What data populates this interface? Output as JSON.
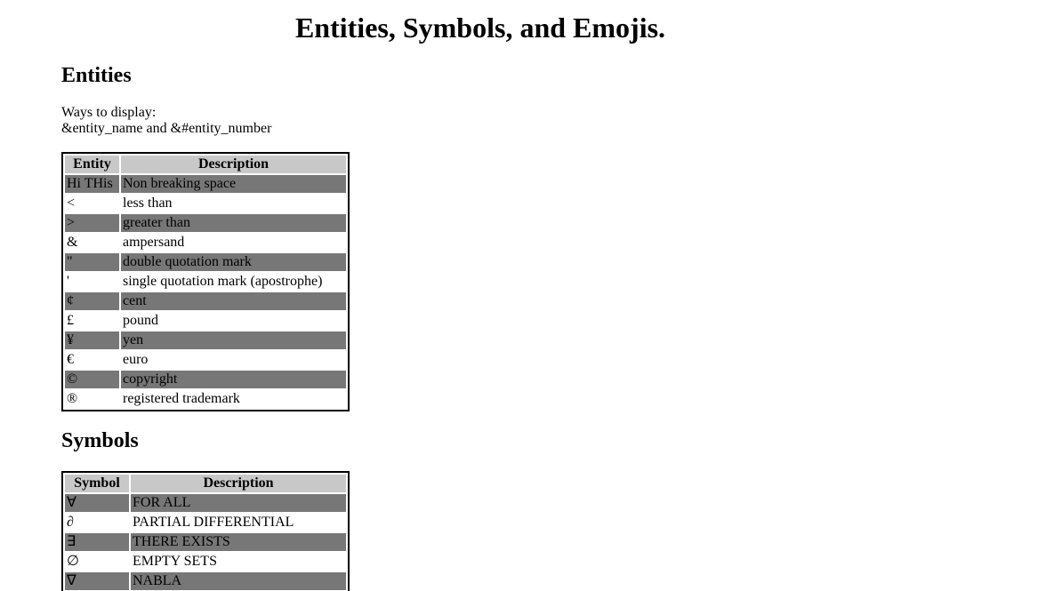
{
  "title": "Entities, Symbols, and Emojis.",
  "entities": {
    "heading": "Entities",
    "intro_line1": "Ways to display:",
    "intro_line2": "&entity_name and &#entity_number",
    "columns": [
      "Entity",
      "Description"
    ],
    "rows": [
      {
        "symbol": "Hi THis",
        "description": "Non breaking space"
      },
      {
        "symbol": "<",
        "description": "less than"
      },
      {
        "symbol": ">",
        "description": "greater than"
      },
      {
        "symbol": "&",
        "description": "ampersand"
      },
      {
        "symbol": "\"",
        "description": "double quotation mark"
      },
      {
        "symbol": "'",
        "description": "single quotation mark (apostrophe)"
      },
      {
        "symbol": "¢",
        "description": "cent"
      },
      {
        "symbol": "£",
        "description": "pound"
      },
      {
        "symbol": "¥",
        "description": "yen"
      },
      {
        "symbol": "€",
        "description": "euro"
      },
      {
        "symbol": "©",
        "description": "copyright"
      },
      {
        "symbol": "®",
        "description": "registered trademark"
      }
    ]
  },
  "symbols": {
    "heading": "Symbols",
    "columns": [
      "Symbol",
      "Description"
    ],
    "rows": [
      {
        "symbol": "∀",
        "description": "FOR ALL"
      },
      {
        "symbol": "∂",
        "description": "PARTIAL DIFFERENTIAL"
      },
      {
        "symbol": "∃",
        "description": "THERE EXISTS"
      },
      {
        "symbol": "∅",
        "description": "EMPTY SETS"
      },
      {
        "symbol": "∇",
        "description": "NABLA"
      }
    ]
  },
  "colors": {
    "header_bg": "#c8c8c8",
    "shaded_row_bg": "#777777",
    "page_bg": "#ffffff"
  }
}
